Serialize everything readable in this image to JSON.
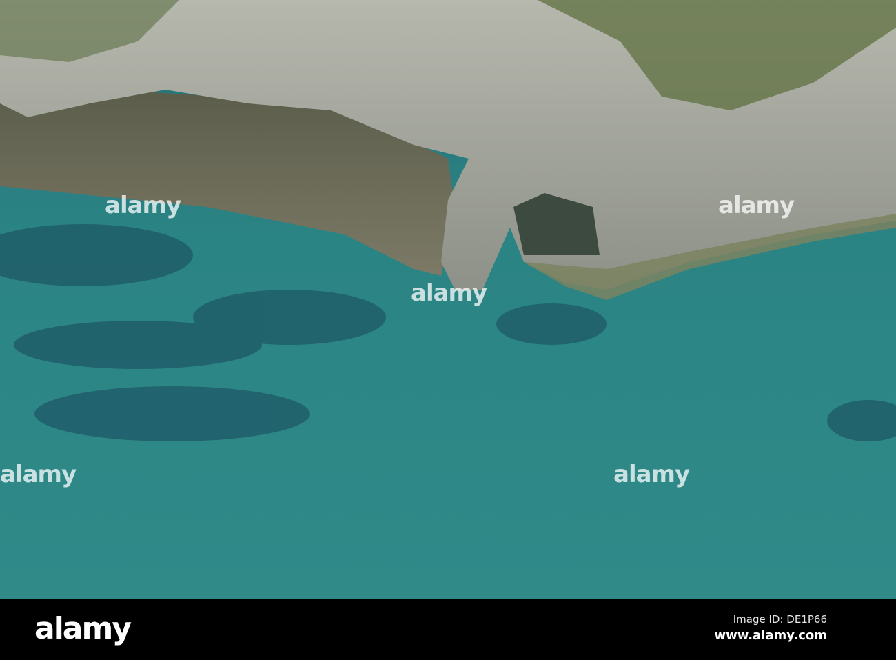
{
  "photo": {
    "subject": "aerial cliffs and sea",
    "colors": {
      "sea": "#2c8585",
      "sea_deep": "#1f5f6a",
      "cliff": "#a9aba2",
      "rocks": "#6b6a58",
      "grass": "#5f7040"
    }
  },
  "watermark": {
    "text": "alamy"
  },
  "footer": {
    "logo": "alamy",
    "image_id": "Image ID: DE1P66",
    "website": "www.alamy.com"
  }
}
